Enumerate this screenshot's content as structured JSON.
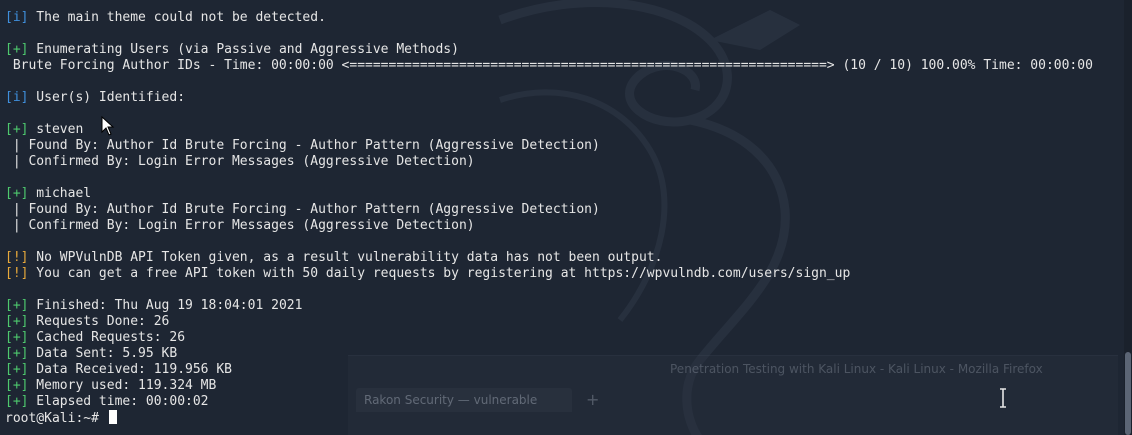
{
  "terminal": {
    "lines": [
      {
        "tag": "[i]",
        "tag_color": "blue",
        "text": " The main theme could not be detected."
      },
      {
        "blank": true
      },
      {
        "tag": "[+]",
        "tag_color": "green",
        "text": " Enumerating Users (via Passive and Aggressive Methods)"
      },
      {
        "tag": "",
        "text": " Brute Forcing Author IDs - Time: 00:00:00 <=============================================================> (10 / 10) 100.00% Time: 00:00:00"
      },
      {
        "blank": true
      },
      {
        "tag": "[i]",
        "tag_color": "blue",
        "text": " User(s) Identified:"
      },
      {
        "blank": true
      },
      {
        "tag": "[+]",
        "tag_color": "green",
        "text": " steven"
      },
      {
        "tag": "",
        "text": " | Found By: Author Id Brute Forcing - Author Pattern (Aggressive Detection)"
      },
      {
        "tag": "",
        "text": " | Confirmed By: Login Error Messages (Aggressive Detection)"
      },
      {
        "blank": true
      },
      {
        "tag": "[+]",
        "tag_color": "green",
        "text": " michael"
      },
      {
        "tag": "",
        "text": " | Found By: Author Id Brute Forcing - Author Pattern (Aggressive Detection)"
      },
      {
        "tag": "",
        "text": " | Confirmed By: Login Error Messages (Aggressive Detection)"
      },
      {
        "blank": true
      },
      {
        "tag": "[!]",
        "tag_color": "orange",
        "text": " No WPVulnDB API Token given, as a result vulnerability data has not been output."
      },
      {
        "tag": "[!]",
        "tag_color": "orange",
        "text": " You can get a free API token with 50 daily requests by registering at https://wpvulndb.com/users/sign_up"
      },
      {
        "blank": true
      },
      {
        "tag": "[+]",
        "tag_color": "green",
        "text": " Finished: Thu Aug 19 18:04:01 2021"
      },
      {
        "tag": "[+]",
        "tag_color": "green",
        "text": " Requests Done: 26"
      },
      {
        "tag": "[+]",
        "tag_color": "green",
        "text": " Cached Requests: 26"
      },
      {
        "tag": "[+]",
        "tag_color": "green",
        "text": " Data Sent: 5.95 KB"
      },
      {
        "tag": "[+]",
        "tag_color": "green",
        "text": " Data Received: 119.956 KB"
      },
      {
        "tag": "[+]",
        "tag_color": "green",
        "text": " Memory used: 119.324 MB"
      },
      {
        "tag": "[+]",
        "tag_color": "green",
        "text": " Elapsed time: 00:00:02"
      }
    ],
    "prompt": "root@Kali:~# "
  },
  "background": {
    "ghost_title": "Penetration Testing with Kali Linux - Kali Linux - Mozilla Firefox",
    "ghost_tab_label": "Rakon Security — vulnerable",
    "ghost_plus": "+"
  },
  "colors": {
    "background": "#1e2633",
    "info_tag": "#3f8fdc",
    "success_tag": "#4ec96e",
    "warning_tag": "#e8a93b",
    "text": "#e6e6e6"
  },
  "icons": {
    "mouse_pointer": "mouse-pointer-icon",
    "text_cursor": "ibeam-cursor-icon",
    "watermark": "kali-dragon-icon"
  }
}
